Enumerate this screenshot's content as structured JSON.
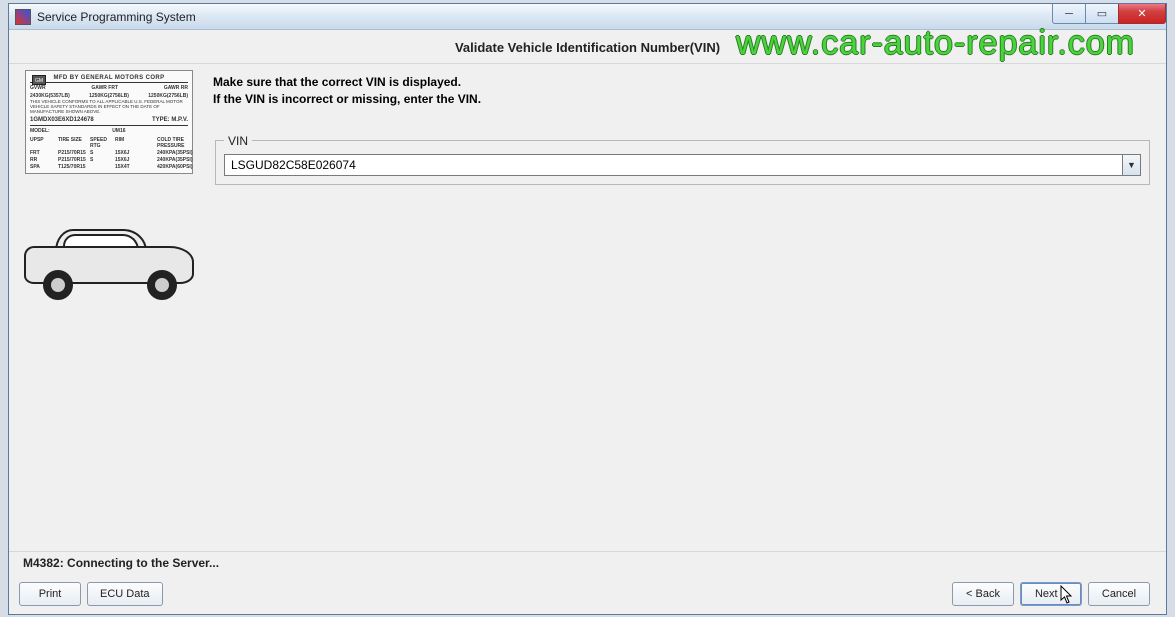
{
  "window": {
    "title": "Service Programming System"
  },
  "page": {
    "heading": "Validate Vehicle Identification Number(VIN)",
    "instruction_line1": "Make sure that the correct VIN is displayed.",
    "instruction_line2": "If the VIN is incorrect or missing, enter the VIN."
  },
  "vin_group": {
    "legend": "VIN",
    "value": "LSGUD82C58E026074"
  },
  "label_card": {
    "header": "MFD BY GENERAL MOTORS CORP",
    "gvwr_label": "GVWR",
    "gvwr_value": "2430KG(5357LB)",
    "gawr_frt_label": "GAWR FRT",
    "gawr_frt_value": "1250KG(2756LB)",
    "gawr_rr_label": "GAWR RR",
    "gawr_rr_value": "1250KG(2756LB)",
    "compliance": "THIS VEHICLE CONFORMS TO ALL APPLICABLE U.S. FEDERAL MOTOR VEHICLE SAFETY STANDARDS IN EFFECT ON THE DATE OF MANUFACTURE SHOWN ABOVE.",
    "vin": "1GMDX03E6XD124678",
    "type": "TYPE: M.P.V.",
    "model_label": "MODEL:",
    "model_value": "UM16",
    "col_upsp": "UPSP",
    "col_tire": "TIRE SIZE",
    "col_speed": "SPEED RTG",
    "col_rim": "RIM",
    "col_pressure": "COLD TIRE PRESSURE",
    "r1c1": "FRT",
    "r1c2": "P215/70R15",
    "r1c3": "S",
    "r1c4": "15X6J",
    "r1c5": "",
    "r1c6": "240KPA(35PSI)",
    "r2c1": "RR",
    "r2c2": "P215/70R15",
    "r2c3": "S",
    "r2c4": "15X6J",
    "r2c5": "",
    "r2c6": "240KPA(35PSI)",
    "r3c1": "SPA",
    "r3c2": "T125/70R15",
    "r3c3": "",
    "r3c4": "15X4T",
    "r3c5": "",
    "r3c6": "420KPA(60PSI)"
  },
  "status": "M4382: Connecting to the Server...",
  "buttons": {
    "print": "Print",
    "ecu_data": "ECU Data",
    "back": "< Back",
    "next": "Next >",
    "cancel": "Cancel"
  },
  "watermark": "www.car-auto-repair.com",
  "icons": {
    "minimize": "─",
    "maximize": "▭",
    "close": "✕",
    "dropdown": "▼"
  }
}
